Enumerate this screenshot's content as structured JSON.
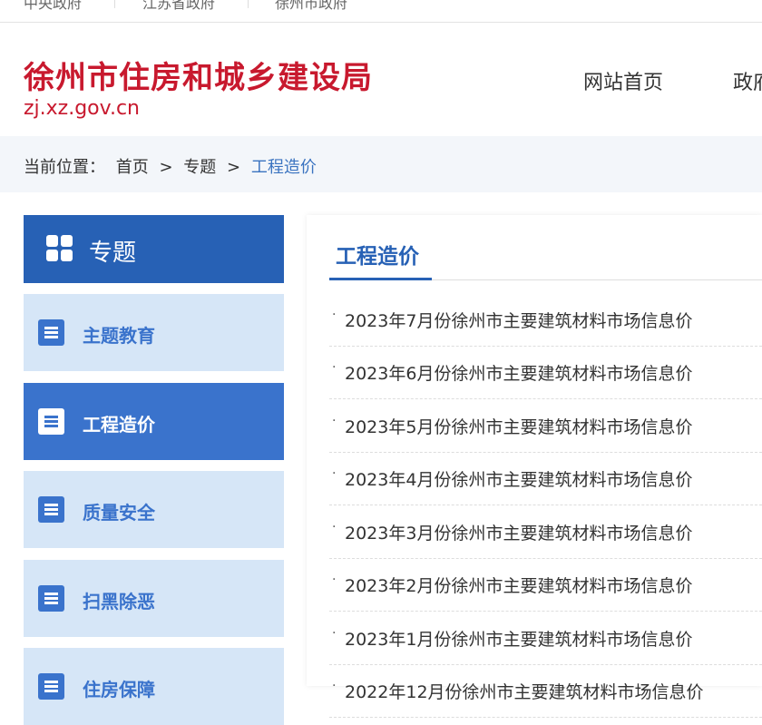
{
  "topbar": {
    "links": [
      "中央政府",
      "江苏省政府",
      "徐州市政府"
    ]
  },
  "header": {
    "title": "徐州市住房和城乡建设局",
    "domain": "zj.xz.gov.cn",
    "nav": [
      "网站首页",
      "政府"
    ]
  },
  "breadcrumb": {
    "prefix": "当前位置：",
    "items": [
      "首页",
      "专题",
      "工程造价"
    ],
    "separator": ">"
  },
  "sidebar": {
    "head_label": "专题",
    "items": [
      {
        "label": "主题教育",
        "active": false
      },
      {
        "label": "工程造价",
        "active": true
      },
      {
        "label": "质量安全",
        "active": false
      },
      {
        "label": "扫黑除恶",
        "active": false
      },
      {
        "label": "住房保障",
        "active": false
      }
    ]
  },
  "content": {
    "title": "工程造价",
    "bullet": "·",
    "items": [
      "2023年7月份徐州市主要建筑材料市场信息价",
      "2023年6月份徐州市主要建筑材料市场信息价",
      "2023年5月份徐州市主要建筑材料市场信息价",
      "2023年4月份徐州市主要建筑材料市场信息价",
      "2023年3月份徐州市主要建筑材料市场信息价",
      "2023年2月份徐州市主要建筑材料市场信息价",
      "2023年1月份徐州市主要建筑材料市场信息价",
      "2022年12月份徐州市主要建筑材料市场信息价"
    ]
  },
  "colors": {
    "brand_red": "#c8192e",
    "primary_blue": "#2761b5",
    "active_blue": "#3a73cc",
    "sidebar_bg": "#d6e6f7"
  },
  "icons": {
    "sidebar_head": "grid-icon",
    "sidebar_item": "document-list-icon"
  }
}
